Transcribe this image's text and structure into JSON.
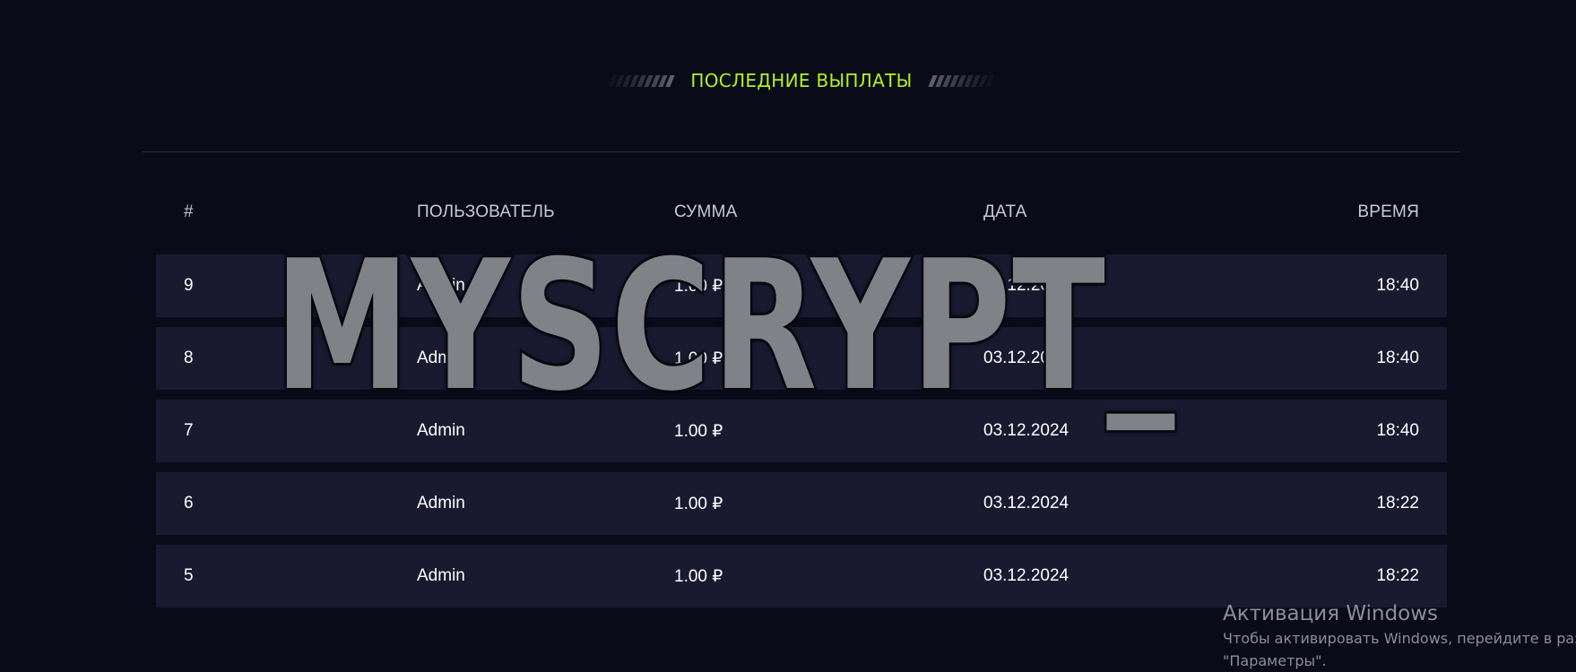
{
  "section": {
    "title": "ПОСЛЕДНИЕ ВЫПЛАТЫ"
  },
  "table": {
    "headers": {
      "num": "#",
      "user": "ПОЛЬЗОВАТЕЛЬ",
      "sum": "СУММА",
      "date": "ДАТА",
      "time": "ВРЕМЯ"
    },
    "rows": [
      {
        "num": "9",
        "user": "Admin",
        "sum": "1.00 ₽",
        "date": "03.12.2024",
        "time": "18:40"
      },
      {
        "num": "8",
        "user": "Admin",
        "sum": "1.00 ₽",
        "date": "03.12.2024",
        "time": "18:40"
      },
      {
        "num": "7",
        "user": "Admin",
        "sum": "1.00 ₽",
        "date": "03.12.2024",
        "time": "18:40"
      },
      {
        "num": "6",
        "user": "Admin",
        "sum": "1.00 ₽",
        "date": "03.12.2024",
        "time": "18:22"
      },
      {
        "num": "5",
        "user": "Admin",
        "sum": "1.00 ₽",
        "date": "03.12.2024",
        "time": "18:22"
      }
    ]
  },
  "watermark": {
    "text": "MYSCRYPT_"
  },
  "windows_activation": {
    "title": "Активация Windows",
    "line1": "Чтобы активировать Windows, перейдите в раздел",
    "line2": "\"Параметры\"."
  },
  "colors": {
    "background": "#0a0b19",
    "row_background": "#191a30",
    "accent": "#b3f222"
  }
}
